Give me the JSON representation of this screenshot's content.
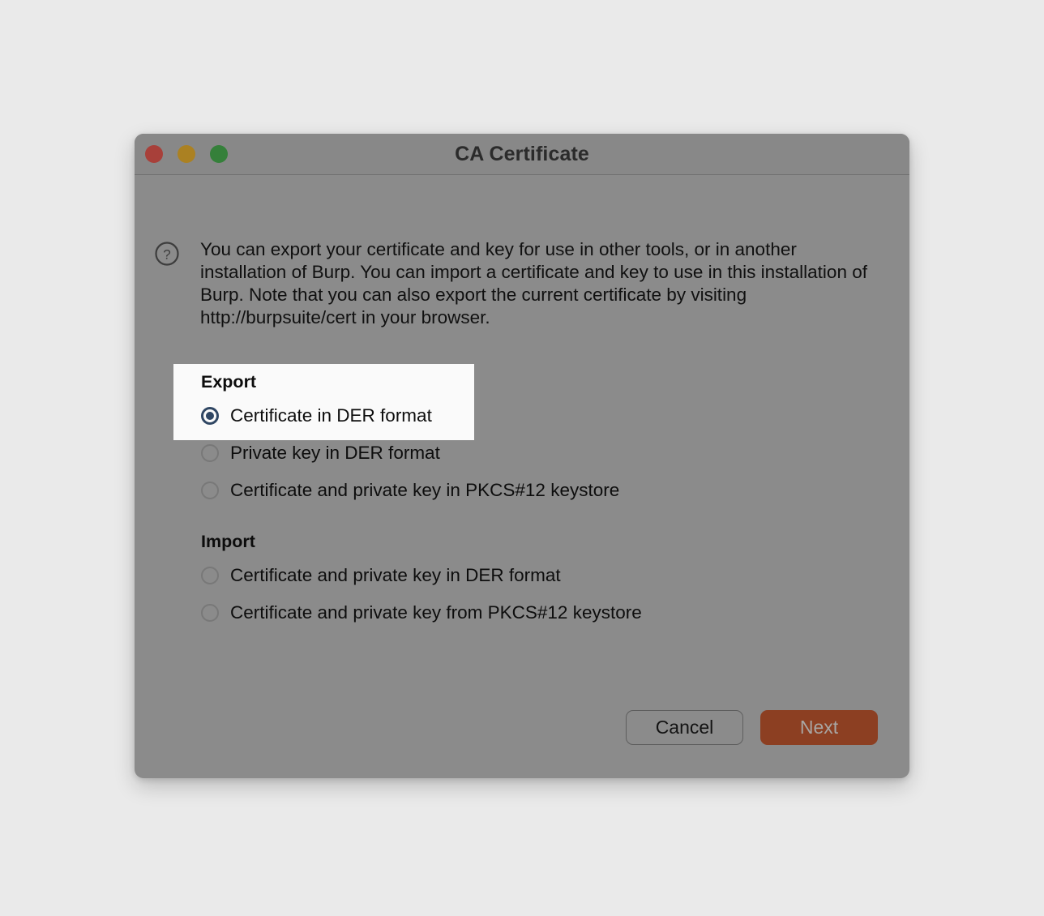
{
  "window": {
    "title": "CA Certificate",
    "controls": [
      {
        "name": "close",
        "color": "#a8403a"
      },
      {
        "name": "minimize",
        "color": "#ab8122"
      },
      {
        "name": "maximize",
        "color": "#35803a"
      }
    ]
  },
  "help": {
    "icon": "question-circle-icon",
    "text": "You can export your certificate and key for use in other tools, or in another installation of Burp. You can import a certificate and key to use in this installation of Burp. Note that you can also export the current certificate by visiting http://burpsuite/cert in your browser."
  },
  "groups": [
    {
      "label": "Export",
      "options": [
        {
          "label": "Certificate in DER format",
          "selected": true
        },
        {
          "label": "Private key in DER format",
          "selected": false
        },
        {
          "label": "Certificate and private key in PKCS#12 keystore",
          "selected": false
        }
      ]
    },
    {
      "label": "Import",
      "options": [
        {
          "label": "Certificate and private key in DER format",
          "selected": false
        },
        {
          "label": "Certificate and private key from PKCS#12 keystore",
          "selected": false
        }
      ]
    }
  ],
  "footer": {
    "cancel_label": "Cancel",
    "next_label": "Next"
  },
  "colors": {
    "dialog_background": "#8b8b8b",
    "titlebar_background": "#888888",
    "page_background": "#eaeaea",
    "highlight_background": "#fafafa",
    "radio_selected": "#2f4663",
    "primary_button": "#8c3f22",
    "primary_button_text": "#a9a6a3"
  }
}
